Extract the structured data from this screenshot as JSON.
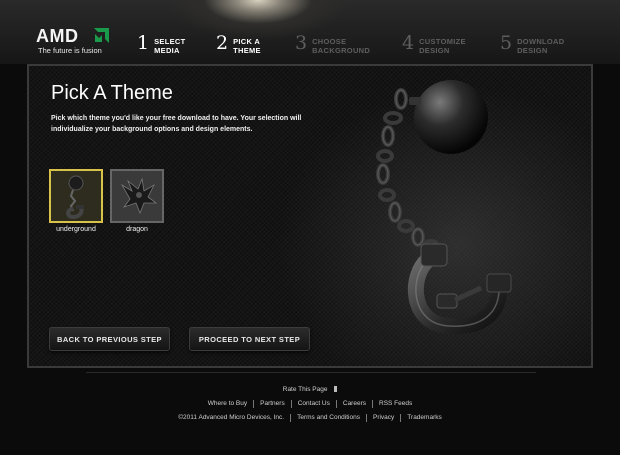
{
  "brand": {
    "logo_text": "AMD",
    "tagline": "The future is fusion",
    "accent_color": "#1a9b4b"
  },
  "steps": [
    {
      "number": "1",
      "line1": "SELECT",
      "line2": "MEDIA",
      "state": "active"
    },
    {
      "number": "2",
      "line1": "PICK A",
      "line2": "THEME",
      "state": "active"
    },
    {
      "number": "3",
      "line1": "CHOOSE",
      "line2": "BACKGROUND",
      "state": "inactive"
    },
    {
      "number": "4",
      "line1": "CUSTOMIZE",
      "line2": "DESIGN",
      "state": "inactive"
    },
    {
      "number": "5",
      "line1": "DOWNLOAD",
      "line2": "DESIGN",
      "state": "inactive"
    }
  ],
  "main": {
    "title": "Pick A Theme",
    "intro": "Pick which theme you'd like your free download to have. Your selection will individualize your background options and design elements.",
    "themes": [
      {
        "label": "underground",
        "selected": true
      },
      {
        "label": "dragon",
        "selected": false
      }
    ],
    "back_button": "BACK TO PREVIOUS STEP",
    "next_button": "PROCEED TO NEXT STEP",
    "selected_border_color": "#d8c24a"
  },
  "footer": {
    "rate_label": "Rate This Page",
    "rate_icon": "thumb-icon",
    "links_row1": [
      "Where to Buy",
      "Partners",
      "Contact Us",
      "Careers",
      "RSS Feeds"
    ],
    "links_row2": [
      "©2011 Advanced Micro Devices, Inc.",
      "Terms and Conditions",
      "Privacy",
      "Trademarks"
    ]
  }
}
